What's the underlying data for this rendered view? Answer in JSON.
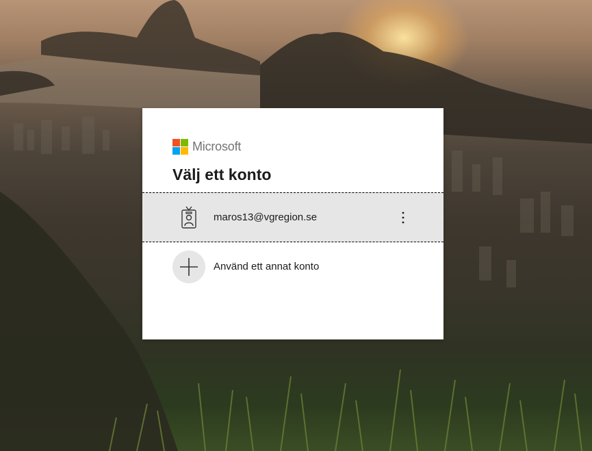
{
  "brand": {
    "name": "Microsoft",
    "colors": [
      "#f25022",
      "#7fba00",
      "#00a4ef",
      "#ffb900"
    ]
  },
  "dialog": {
    "title": "Välj ett konto",
    "accounts": [
      {
        "email": "maros13@vgregion.se",
        "icon": "badge-person-icon",
        "menu_icon": "more-options-icon"
      }
    ],
    "other_account": {
      "label": "Använd ett annat konto",
      "icon": "plus-icon"
    }
  }
}
